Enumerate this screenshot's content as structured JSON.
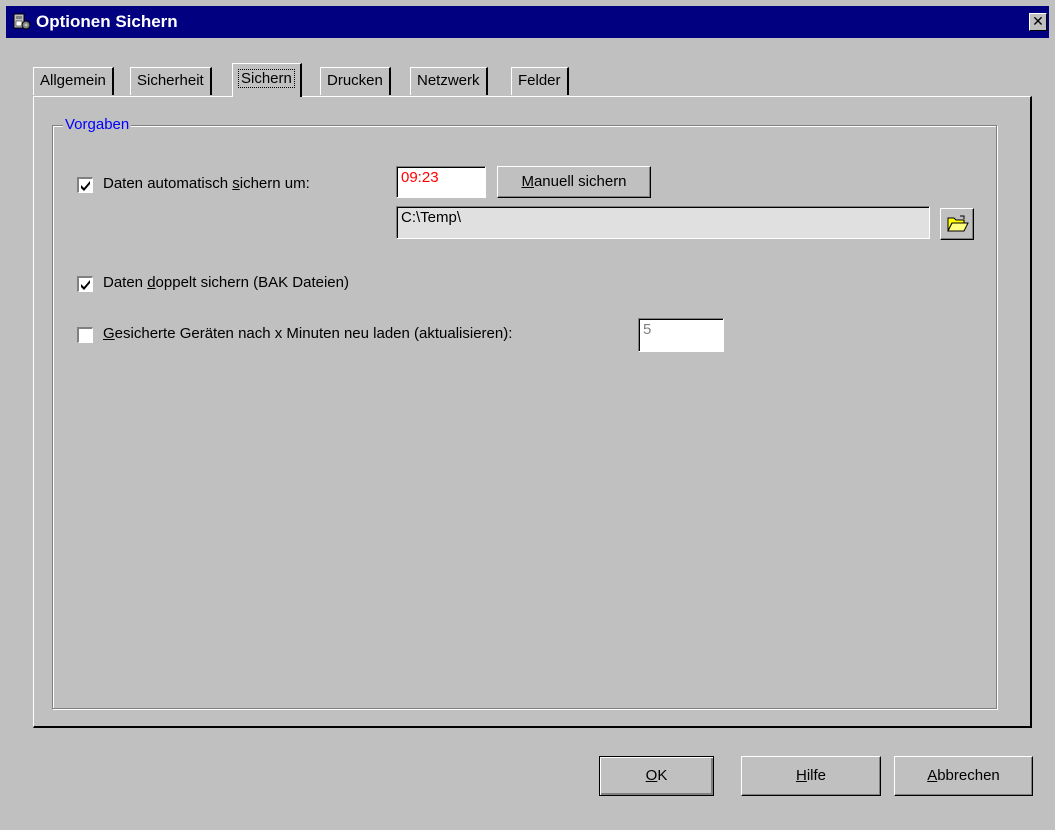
{
  "window": {
    "title": "Optionen Sichern",
    "close_glyph": "✕"
  },
  "tabs": [
    {
      "label": "Allgemein"
    },
    {
      "label": "Sicherheit"
    },
    {
      "label": "Sichern",
      "active": true
    },
    {
      "label": "Drucken"
    },
    {
      "label": "Netzwerk"
    },
    {
      "label": "Felder"
    }
  ],
  "group": {
    "legend": "Vorgaben",
    "legend_color": "#0000ff"
  },
  "auto_save": {
    "checked": true,
    "label_pre": "Daten automatisch ",
    "label_hotkey": "s",
    "label_post": "ichern um:",
    "time_value": "09:23",
    "time_color": "#ff0000",
    "manual_pre": "",
    "manual_hotkey": "M",
    "manual_post": "anuell sichern",
    "path_value": "C:\\Temp\\",
    "folder_icon": "folder-open-icon"
  },
  "double_save": {
    "checked": true,
    "label_pre": "Daten ",
    "label_hotkey": "d",
    "label_post": "oppelt sichern (BAK Dateien)"
  },
  "reload": {
    "checked": false,
    "label_pre": "",
    "label_hotkey": "G",
    "label_post": "esicherte Geräten nach x Minuten neu laden (aktualisieren):",
    "minutes_value": "5"
  },
  "buttons": {
    "ok_hotkey": "O",
    "ok_post": "K",
    "help_hotkey": "H",
    "help_post": "ilfe",
    "cancel_hotkey": "A",
    "cancel_post": "bbrechen"
  }
}
